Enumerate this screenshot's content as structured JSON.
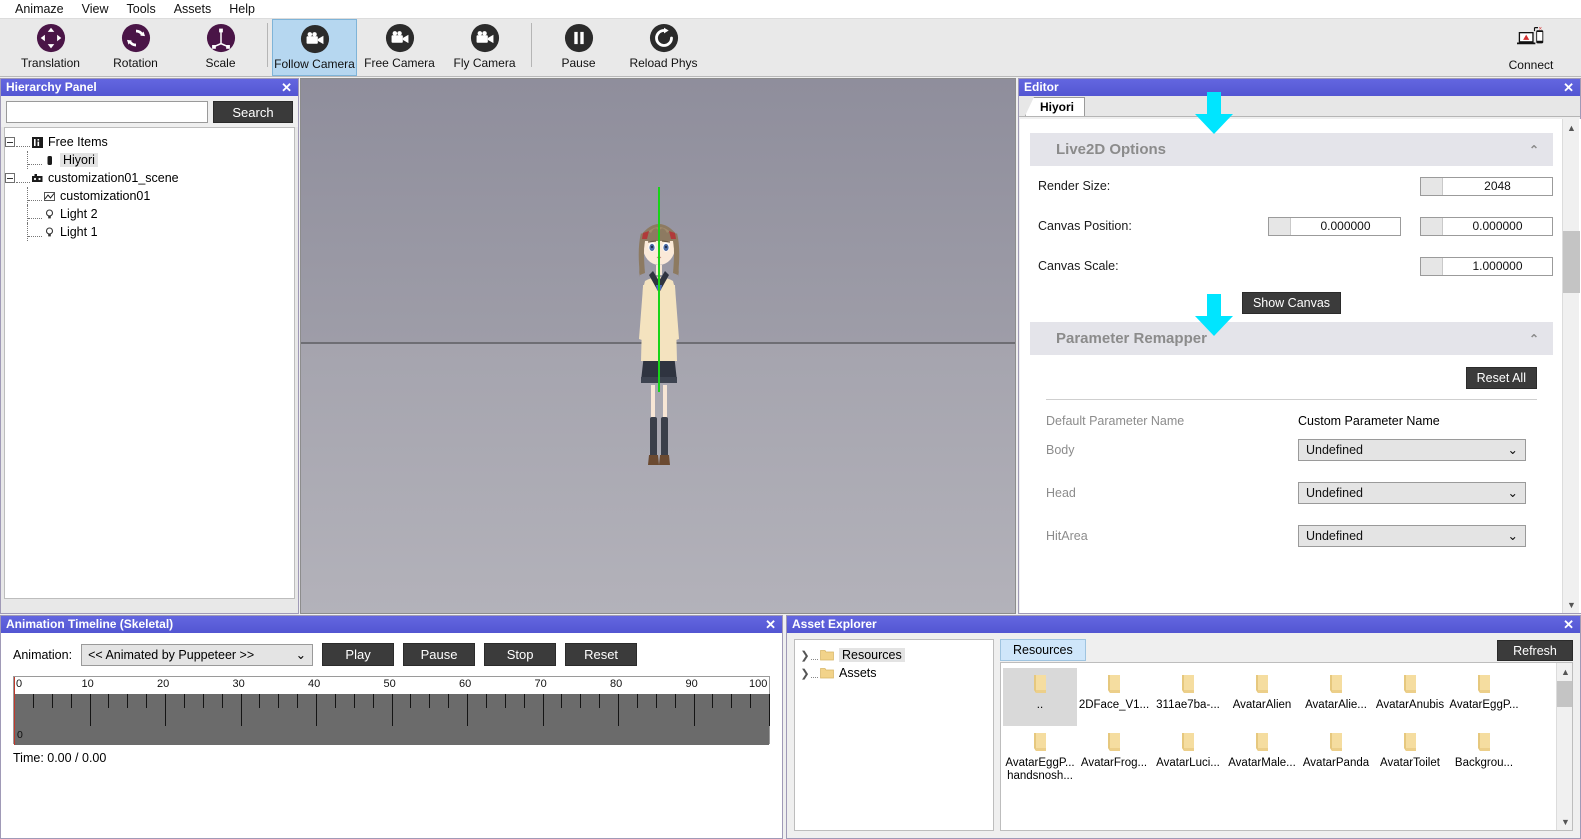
{
  "app": {
    "title": "Animaze"
  },
  "menubar": {
    "items": [
      {
        "label": "Animaze",
        "name": "menu-animaze"
      },
      {
        "label": "View",
        "name": "menu-view"
      },
      {
        "label": "Tools",
        "name": "menu-tools"
      },
      {
        "label": "Assets",
        "name": "menu-assets"
      },
      {
        "label": "Help",
        "name": "menu-help"
      }
    ]
  },
  "toolbar": {
    "buttons": [
      {
        "label": "Translation",
        "icon": "translation-icon",
        "selected": false
      },
      {
        "label": "Rotation",
        "icon": "rotation-icon",
        "selected": false
      },
      {
        "label": "Scale",
        "icon": "scale-icon",
        "selected": false
      },
      {
        "label": "Follow Camera",
        "icon": "camera-icon",
        "selected": true
      },
      {
        "label": "Free Camera",
        "icon": "camera-icon",
        "selected": false
      },
      {
        "label": "Fly Camera",
        "icon": "camera-icon",
        "selected": false
      },
      {
        "label": "Pause",
        "icon": "pause-icon",
        "selected": false
      },
      {
        "label": "Reload Phys",
        "icon": "reload-icon",
        "selected": false
      }
    ],
    "connect": {
      "label": "Connect",
      "icon": "connect-devices-icon"
    }
  },
  "hierarchy": {
    "title": "Hierarchy Panel",
    "search_value": "",
    "search_placeholder": "",
    "search_button": "Search",
    "tree": [
      {
        "label": "Free Items",
        "depth": 0,
        "icon": "info-item-icon",
        "expander": true,
        "selected": false
      },
      {
        "label": "Hiyori",
        "depth": 1,
        "icon": "avatar-item-icon",
        "expander": false,
        "selected": true
      },
      {
        "label": "customization01_scene",
        "depth": 0,
        "icon": "scene-icon",
        "expander": true,
        "selected": false
      },
      {
        "label": "customization01",
        "depth": 1,
        "icon": "mesh-icon",
        "expander": false,
        "selected": false
      },
      {
        "label": "Light 2",
        "depth": 1,
        "icon": "light-icon",
        "expander": false,
        "selected": false
      },
      {
        "label": "Light 1",
        "depth": 1,
        "icon": "light-icon",
        "expander": false,
        "selected": false
      }
    ]
  },
  "viewport": {
    "avatar_name": "Hiyori",
    "gizmo": "vertical-axis-green"
  },
  "editor": {
    "title": "Editor",
    "tabs": [
      {
        "label": "Hiyori",
        "active": true
      }
    ],
    "live2d": {
      "section_title": "Live2D Options",
      "collapsed": false,
      "render_size_label": "Render Size:",
      "render_size_value": "2048",
      "canvas_position_label": "Canvas Position:",
      "canvas_position_x": "0.000000",
      "canvas_position_y": "0.000000",
      "canvas_scale_label": "Canvas Scale:",
      "canvas_scale_value": "1.000000",
      "show_canvas_button": "Show Canvas"
    },
    "remapper": {
      "section_title": "Parameter Remapper",
      "collapsed": false,
      "reset_all_button": "Reset All",
      "col_default": "Default Parameter Name",
      "col_custom": "Custom Parameter Name",
      "rows": [
        {
          "name": "Body",
          "value": "Undefined"
        },
        {
          "name": "Head",
          "value": "Undefined"
        },
        {
          "name": "HitArea",
          "value": "Undefined"
        }
      ]
    }
  },
  "timeline": {
    "title": "Animation Timeline (Skeletal)",
    "animation_label": "Animation:",
    "animation_value": "<< Animated by Puppeteer >>",
    "buttons": [
      "Play",
      "Pause",
      "Stop",
      "Reset"
    ],
    "ruler_ticks": [
      "0",
      "10",
      "20",
      "30",
      "40",
      "50",
      "60",
      "70",
      "80",
      "90",
      "100"
    ],
    "playhead_label": "0",
    "time_text": "Time: 0.00 / 0.00"
  },
  "assets": {
    "title": "Asset Explorer",
    "tree": [
      {
        "label": "Resources",
        "selected": true
      },
      {
        "label": "Assets",
        "selected": false
      }
    ],
    "current_tab": "Resources",
    "refresh_button": "Refresh",
    "items": [
      {
        "label": "..",
        "selected": true
      },
      {
        "label": "2DFace_V1...",
        "selected": false
      },
      {
        "label": "311ae7ba-...",
        "selected": false
      },
      {
        "label": "AvatarAlien",
        "selected": false
      },
      {
        "label": "AvatarAlie...",
        "selected": false
      },
      {
        "label": "AvatarAnubis",
        "selected": false
      },
      {
        "label": "AvatarEggP...",
        "selected": false
      },
      {
        "label": "AvatarEggP... handsnosh...",
        "selected": false
      },
      {
        "label": "AvatarFrog...",
        "selected": false
      },
      {
        "label": "AvatarLuci...",
        "selected": false
      },
      {
        "label": "AvatarMale...",
        "selected": false
      },
      {
        "label": "AvatarPanda",
        "selected": false
      },
      {
        "label": "AvatarToilet",
        "selected": false
      },
      {
        "label": "Backgrou...",
        "selected": false
      }
    ]
  },
  "annotations": {
    "arrow_color": "#00e5ff",
    "arrows": [
      {
        "name": "arrow-pointing-editor-tab"
      },
      {
        "name": "arrow-pointing-parameter-remapper"
      }
    ]
  },
  "colors": {
    "panel_title_bg": "#5b5fd4",
    "toolbar_selected": "#b6d7f0",
    "dark_button": "#3b3b3b",
    "accent_cyan": "#00e5ff",
    "gizmo_green": "#18d418"
  }
}
